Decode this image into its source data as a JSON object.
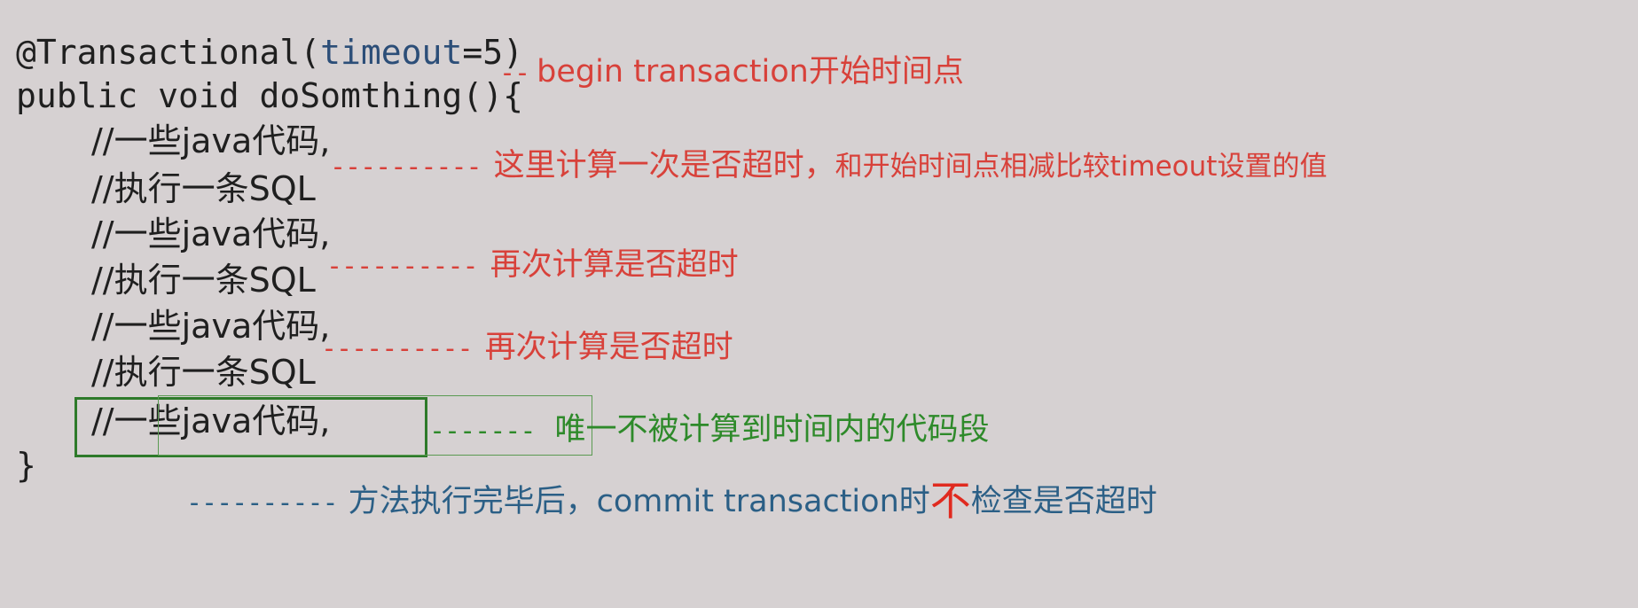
{
  "code": {
    "annotation_prefix": "@Transactional(",
    "annotation_param": "timeout",
    "annotation_suffix": "=5)",
    "signature": "public void doSomthing(){",
    "lines": [
      "//一些java代码,",
      "//执行一条SQL",
      "//一些java代码,",
      "//执行一条SQL",
      "//一些java代码,",
      "//执行一条SQL",
      "//一些java代码,"
    ],
    "closing_brace": "}"
  },
  "notes": {
    "begin": {
      "dash": "--",
      "text": "begin transaction开始时间点"
    },
    "check1": {
      "dash": "----------",
      "text": "这里计算一次是否超时，",
      "text_small": "和开始时间点相减比较timeout设置的值"
    },
    "check2": {
      "dash": "----------",
      "text": "再次计算是否超时"
    },
    "check3": {
      "dash": "----------",
      "text": "再次计算是否超时"
    },
    "uncounted": {
      "dash": "-------",
      "text": "唯一不被计算到时间内的代码段"
    },
    "commit": {
      "dash": "----------",
      "text_before": "方法执行完毕后，commit transaction时",
      "text_emph": "不",
      "text_after": "检查是否超时"
    }
  },
  "colors": {
    "background": "#d6d1d2",
    "code": "#1f1f1f",
    "keyword": "#2c4e78",
    "red_note": "#d8413a",
    "green_note": "#2e8a2a",
    "blue_note": "#2b5f86",
    "emphasis": "#e02a1f"
  }
}
